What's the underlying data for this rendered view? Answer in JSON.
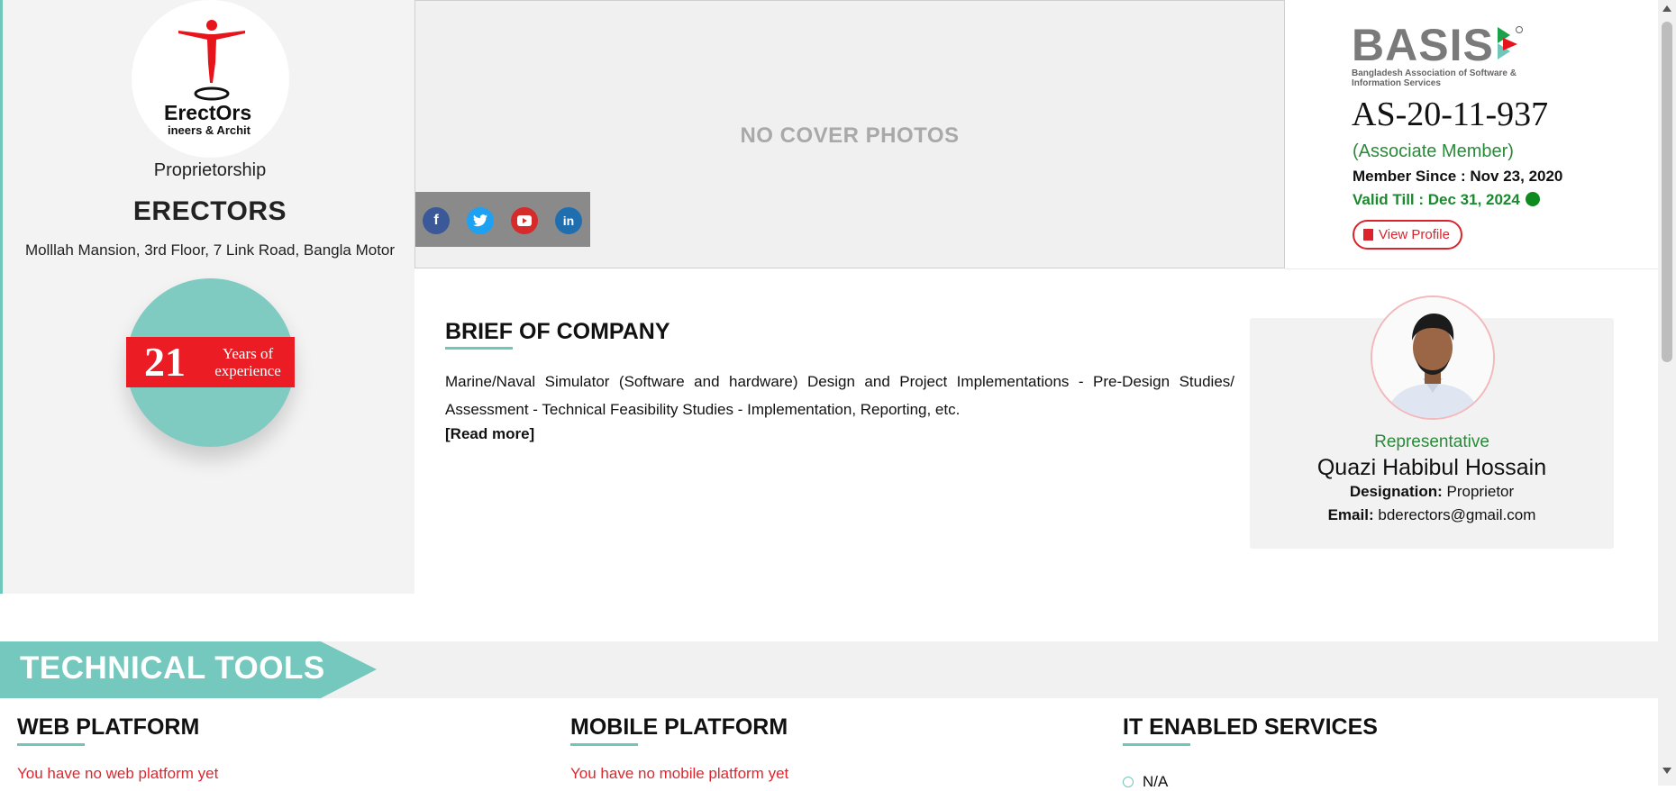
{
  "company": {
    "logo_text": "ErectOrs",
    "logo_tagline": "ineers & Archit",
    "org_type": "Proprietorship",
    "name": "ERECTORS",
    "address": "Molllah Mansion, 3rd Floor, 7 Link Road, Bangla Motor",
    "experience_years": "21",
    "experience_label": "Years of experience"
  },
  "cover": {
    "placeholder": "NO COVER PHOTOS",
    "social_icons": [
      "facebook-icon",
      "twitter-icon",
      "youtube-icon",
      "linkedin-icon"
    ]
  },
  "membership": {
    "logo_word": "BASIS",
    "logo_subtitle": "Bangladesh Association of Software & Information Services",
    "member_id": "AS-20-11-937",
    "member_type": "(Associate Member)",
    "member_since": "Member Since : Nov 23, 2020",
    "valid_till": "Valid Till : Dec 31, 2024",
    "view_profile_label": "View Profile"
  },
  "brief": {
    "title": "BRIEF OF COMPANY",
    "text": "Marine/Naval Simulator (Software and hardware) Design and Project Implementations - Pre-Design Studies/ Assessment - Technical Feasibility Studies - Implementation, Reporting, etc.",
    "read_more": "[Read more]"
  },
  "representative": {
    "role": "Representative",
    "name": "Quazi Habibul Hossain",
    "designation_label": "Designation:",
    "designation": "Proprietor",
    "email_label": "Email:",
    "email": "bderectors@gmail.com"
  },
  "technical_tools": {
    "banner": "TECHNICAL TOOLS",
    "web": {
      "title": "WEB PLATFORM",
      "empty": "You have no web platform yet"
    },
    "mobile": {
      "title": "MOBILE PLATFORM",
      "empty": "You have no mobile platform yet"
    },
    "ites": {
      "title": "IT ENABLED SERVICES",
      "items": [
        "N/A"
      ]
    }
  },
  "colors": {
    "accent_teal": "#6fc7ba",
    "experience_red": "#ec1c24",
    "valid_green": "#1a8a2e",
    "empty_red": "#e0262e"
  }
}
